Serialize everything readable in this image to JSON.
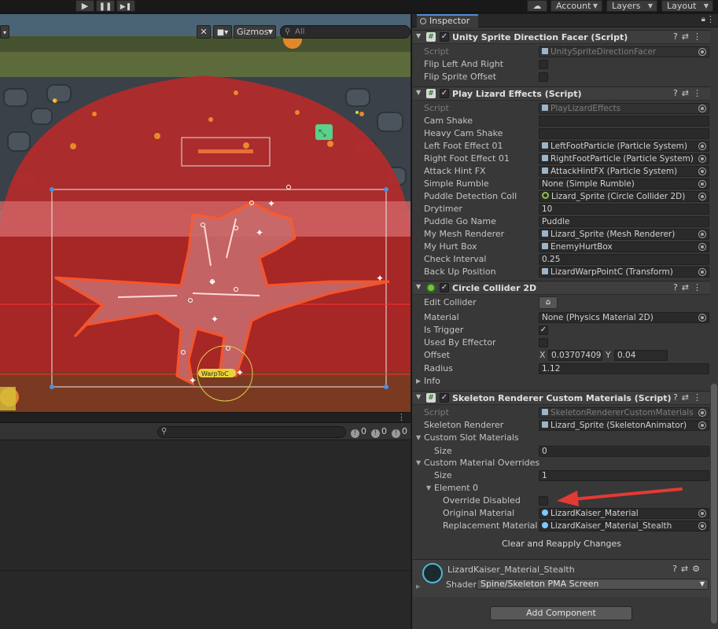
{
  "toolbar": {
    "play_icon": "play-icon",
    "pause_icon": "pause-icon",
    "step_icon": "step-icon",
    "cloud_icon": "cloud-icon",
    "account_label": "Account",
    "layers_label": "Layers",
    "layout_label": "Layout"
  },
  "scene": {
    "gizmos_label": "Gizmos",
    "search_placeholder": "All",
    "warp_label": "WarpToC"
  },
  "console": {
    "info_count": "0",
    "warn_count": "0",
    "error_count": "0"
  },
  "inspector": {
    "tab_label": "Inspector",
    "components": [
      {
        "title": "Unity Sprite Direction Facer (Script)",
        "rows": [
          {
            "label": "Script",
            "value": "UnitySpriteDirectionFacer",
            "type": "object",
            "dim": true
          },
          {
            "label": "Flip Left And Right",
            "type": "checkbox",
            "checked": false
          },
          {
            "label": "Flip Sprite Offset",
            "type": "checkbox",
            "checked": false
          }
        ]
      },
      {
        "title": "Play Lizard Effects (Script)",
        "rows": [
          {
            "label": "Script",
            "value": "PlayLizardEffects",
            "type": "object",
            "dim": true
          },
          {
            "label": "Cam Shake",
            "value": "",
            "type": "text"
          },
          {
            "label": "Heavy Cam Shake",
            "value": "",
            "type": "text"
          },
          {
            "label": "Left Foot Effect 01",
            "value": "LeftFootParticle (Particle System)",
            "type": "object"
          },
          {
            "label": "Right Foot Effect 01",
            "value": "RightFootParticle (Particle System)",
            "type": "object"
          },
          {
            "label": "Attack Hint FX",
            "value": "AttackHintFX (Particle System)",
            "type": "object"
          },
          {
            "label": "Simple Rumble",
            "value": "None (Simple Rumble)",
            "type": "object"
          },
          {
            "label": "Puddle Detection Coll",
            "value": "Lizard_Sprite (Circle Collider 2D)",
            "type": "object"
          },
          {
            "label": "Drytimer",
            "value": "10",
            "type": "text"
          },
          {
            "label": "Puddle Go Name",
            "value": "Puddle",
            "type": "text"
          },
          {
            "label": "My Mesh Renderer",
            "value": "Lizard_Sprite (Mesh Renderer)",
            "type": "object"
          },
          {
            "label": "My Hurt Box",
            "value": "EnemyHurtBox",
            "type": "object"
          },
          {
            "label": "Check Interval",
            "value": "0.25",
            "type": "text"
          },
          {
            "label": "Back Up Position",
            "value": "LizardWarpPointC (Transform)",
            "type": "object"
          }
        ]
      },
      {
        "title": "Circle Collider 2D",
        "rows": [
          {
            "label": "Edit Collider",
            "type": "button"
          },
          {
            "label": "Material",
            "value": "None (Physics Material 2D)",
            "type": "object"
          },
          {
            "label": "Is Trigger",
            "type": "checkbox",
            "checked": true
          },
          {
            "label": "Used By Effector",
            "type": "checkbox",
            "checked": false
          },
          {
            "label": "Offset",
            "type": "vector2",
            "x_label": "X",
            "x": "0.03707409",
            "y_label": "Y",
            "y": "0.04"
          },
          {
            "label": "Radius",
            "value": "1.12",
            "type": "text"
          },
          {
            "label": "Info",
            "type": "foldout"
          }
        ]
      },
      {
        "title": "Skeleton Renderer Custom Materials (Script)",
        "rows": [
          {
            "label": "Script",
            "value": "SkeletonRendererCustomMaterials",
            "type": "object",
            "dim": true
          },
          {
            "label": "Skeleton Renderer",
            "value": "Lizard_Sprite (SkeletonAnimator)",
            "type": "object"
          },
          {
            "label": "Custom Slot Materials",
            "type": "foldout"
          },
          {
            "label": "Size",
            "value": "0",
            "type": "text"
          },
          {
            "label": "Custom Material Overrides",
            "type": "foldout"
          },
          {
            "label": "Size",
            "value": "1",
            "type": "text"
          },
          {
            "label": "Element 0",
            "type": "foldout"
          },
          {
            "label": "Override Disabled",
            "type": "checkbox",
            "checked": false
          },
          {
            "label": "Original Material",
            "value": "LizardKaiser_Material",
            "type": "object"
          },
          {
            "label": "Replacement Material",
            "value": "LizardKaiser_Material_Stealth",
            "type": "object"
          }
        ],
        "button_label": "Clear and Reapply Changes"
      }
    ],
    "material": {
      "name": "LizardKaiser_Material_Stealth",
      "shader_label": "Shader",
      "shader_value": "Spine/Skeleton PMA Screen"
    },
    "add_component_label": "Add Component"
  },
  "colors": {
    "accent": "#4d8cd6",
    "arrow": "#e53935",
    "collider_red": "#d62a2a"
  }
}
